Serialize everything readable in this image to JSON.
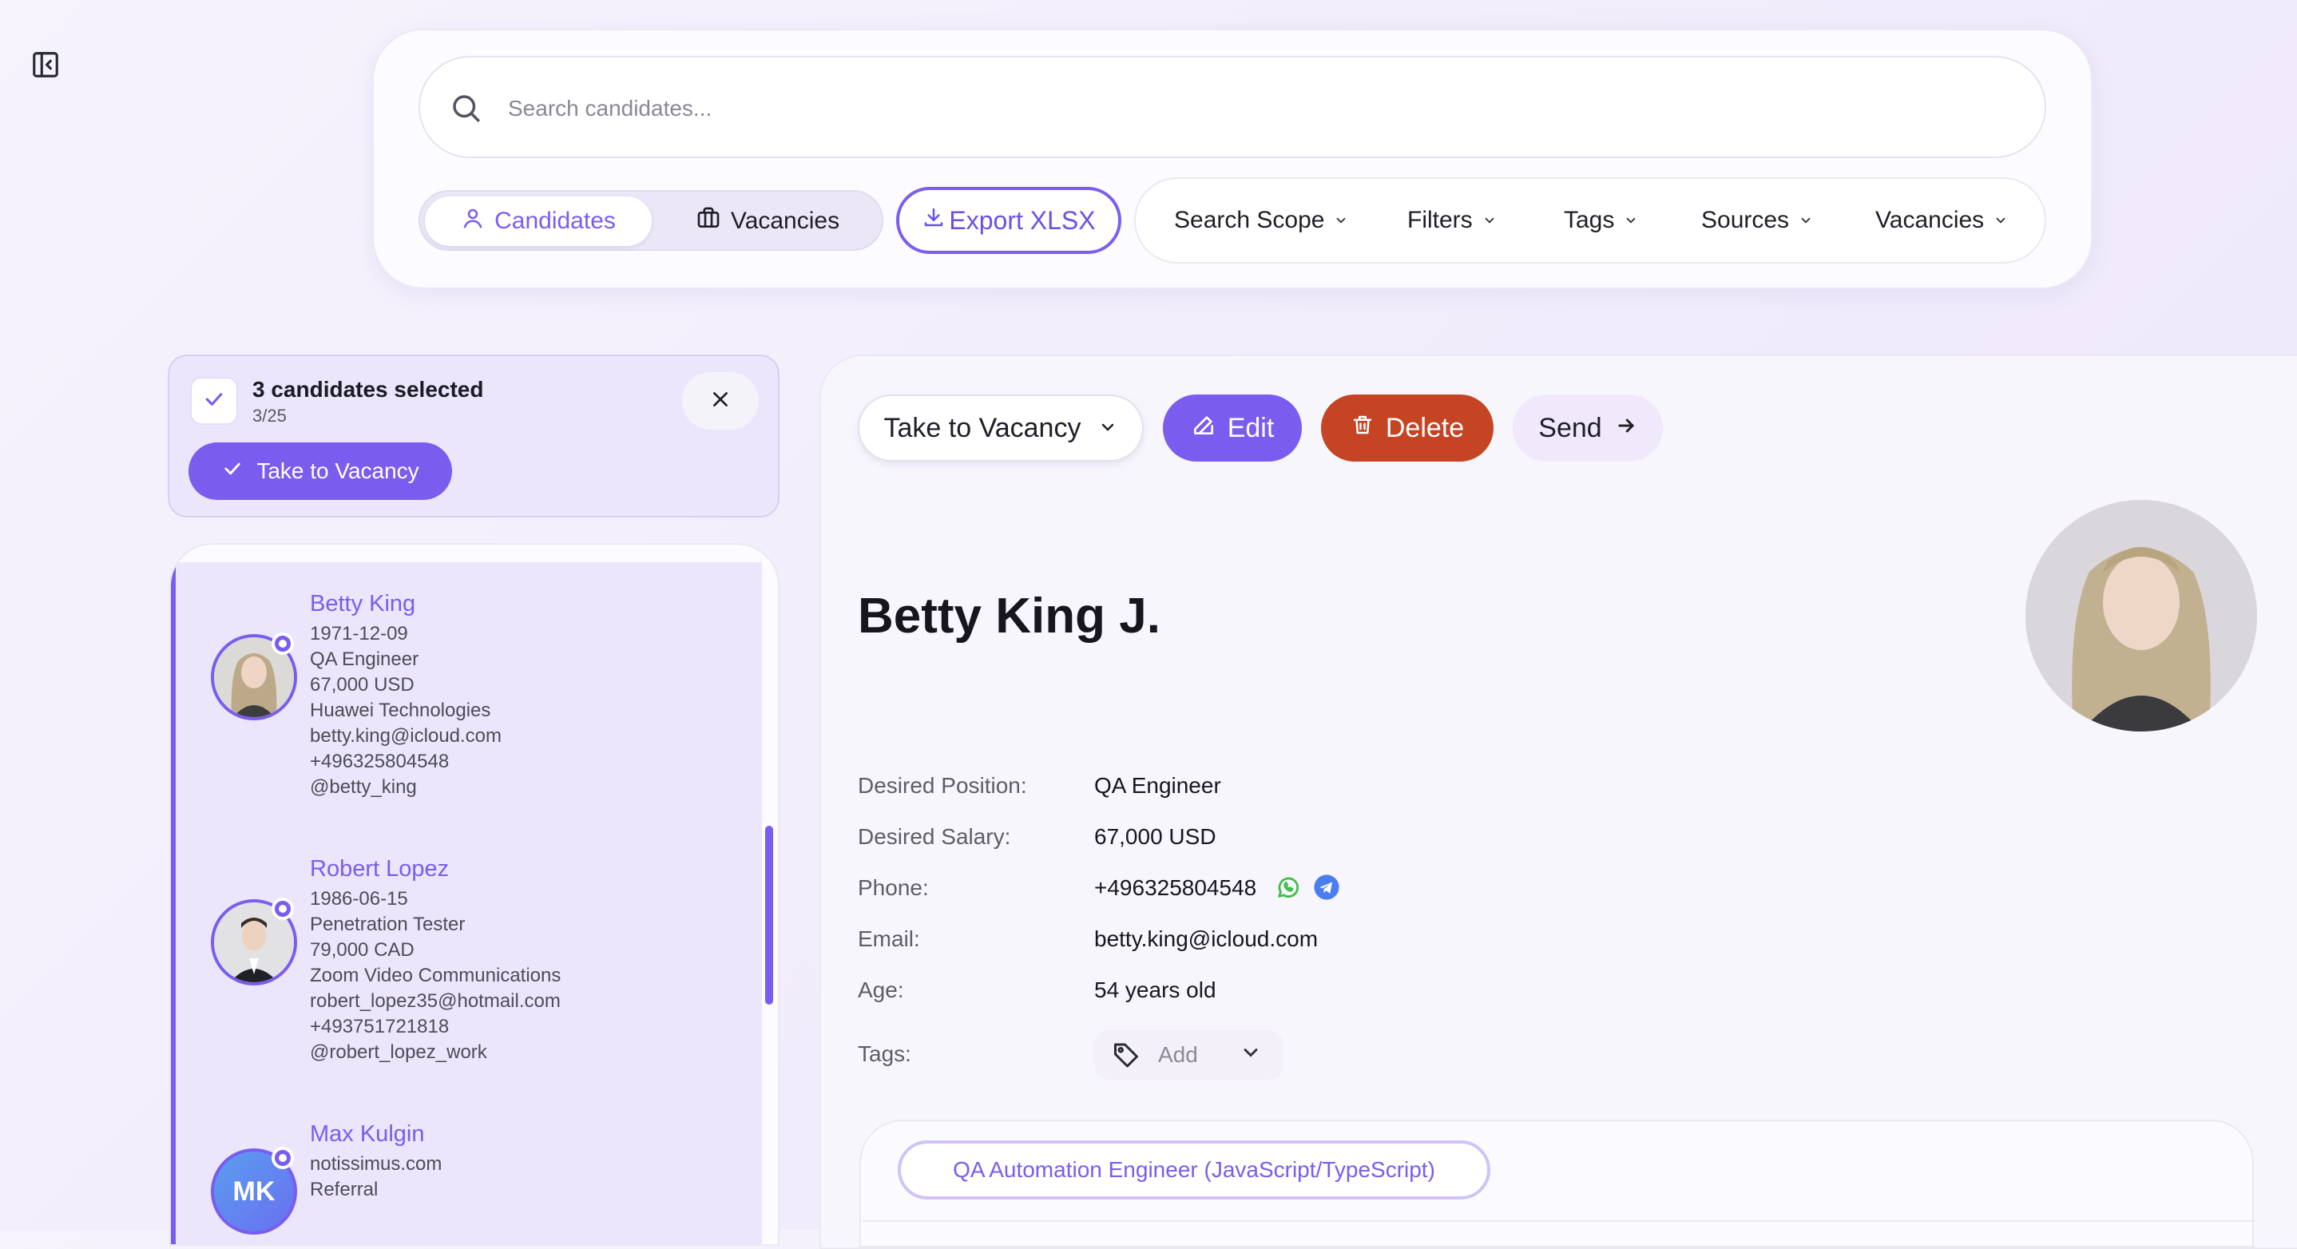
{
  "search": {
    "placeholder": "Search candidates..."
  },
  "tabs": {
    "candidates": "Candidates",
    "vacancies": "Vacancies"
  },
  "export_label": "Export XLSX",
  "filters": [
    "Search Scope",
    "Filters",
    "Tags",
    "Sources",
    "Vacancies"
  ],
  "selection": {
    "title": "3 candidates selected",
    "count": "3/25",
    "take_label": "Take to Vacancy"
  },
  "candidates": [
    {
      "name": "Betty King",
      "lines": [
        "1971-12-09",
        "QA Engineer",
        "67,000 USD",
        "Huawei Technologies",
        "betty.king@icloud.com",
        "+496325804548",
        "@betty_king"
      ]
    },
    {
      "name": "Robert Lopez",
      "lines": [
        "1986-06-15",
        "Penetration Tester",
        "79,000 CAD",
        "Zoom Video Communications",
        "robert_lopez35@hotmail.com",
        "+493751721818",
        "@robert_lopez_work"
      ]
    },
    {
      "name": "Max Kulgin",
      "initials": "MK",
      "lines": [
        "notissimus.com",
        "Referral"
      ]
    }
  ],
  "toolbar": {
    "take_label": "Take to Vacancy",
    "edit_label": "Edit",
    "delete_label": "Delete",
    "send_label": "Send"
  },
  "detail": {
    "name": "Betty King J.",
    "fields": [
      {
        "label": "Desired Position:",
        "value": "QA Engineer"
      },
      {
        "label": "Desired Salary:",
        "value": "67,000 USD"
      },
      {
        "label": "Phone:",
        "value": "+496325804548"
      },
      {
        "label": "Email:",
        "value": "betty.king@icloud.com"
      },
      {
        "label": "Age:",
        "value": "54 years old"
      }
    ],
    "tags_label": "Tags:",
    "tags_add": "Add",
    "vacancy_chip": "QA Automation Engineer (JavaScript/TypeScript)"
  },
  "colors": {
    "accent": "#7a5cef",
    "danger": "#c44424",
    "whatsapp": "#3fbf4a",
    "telegram": "#4a7ef0"
  }
}
